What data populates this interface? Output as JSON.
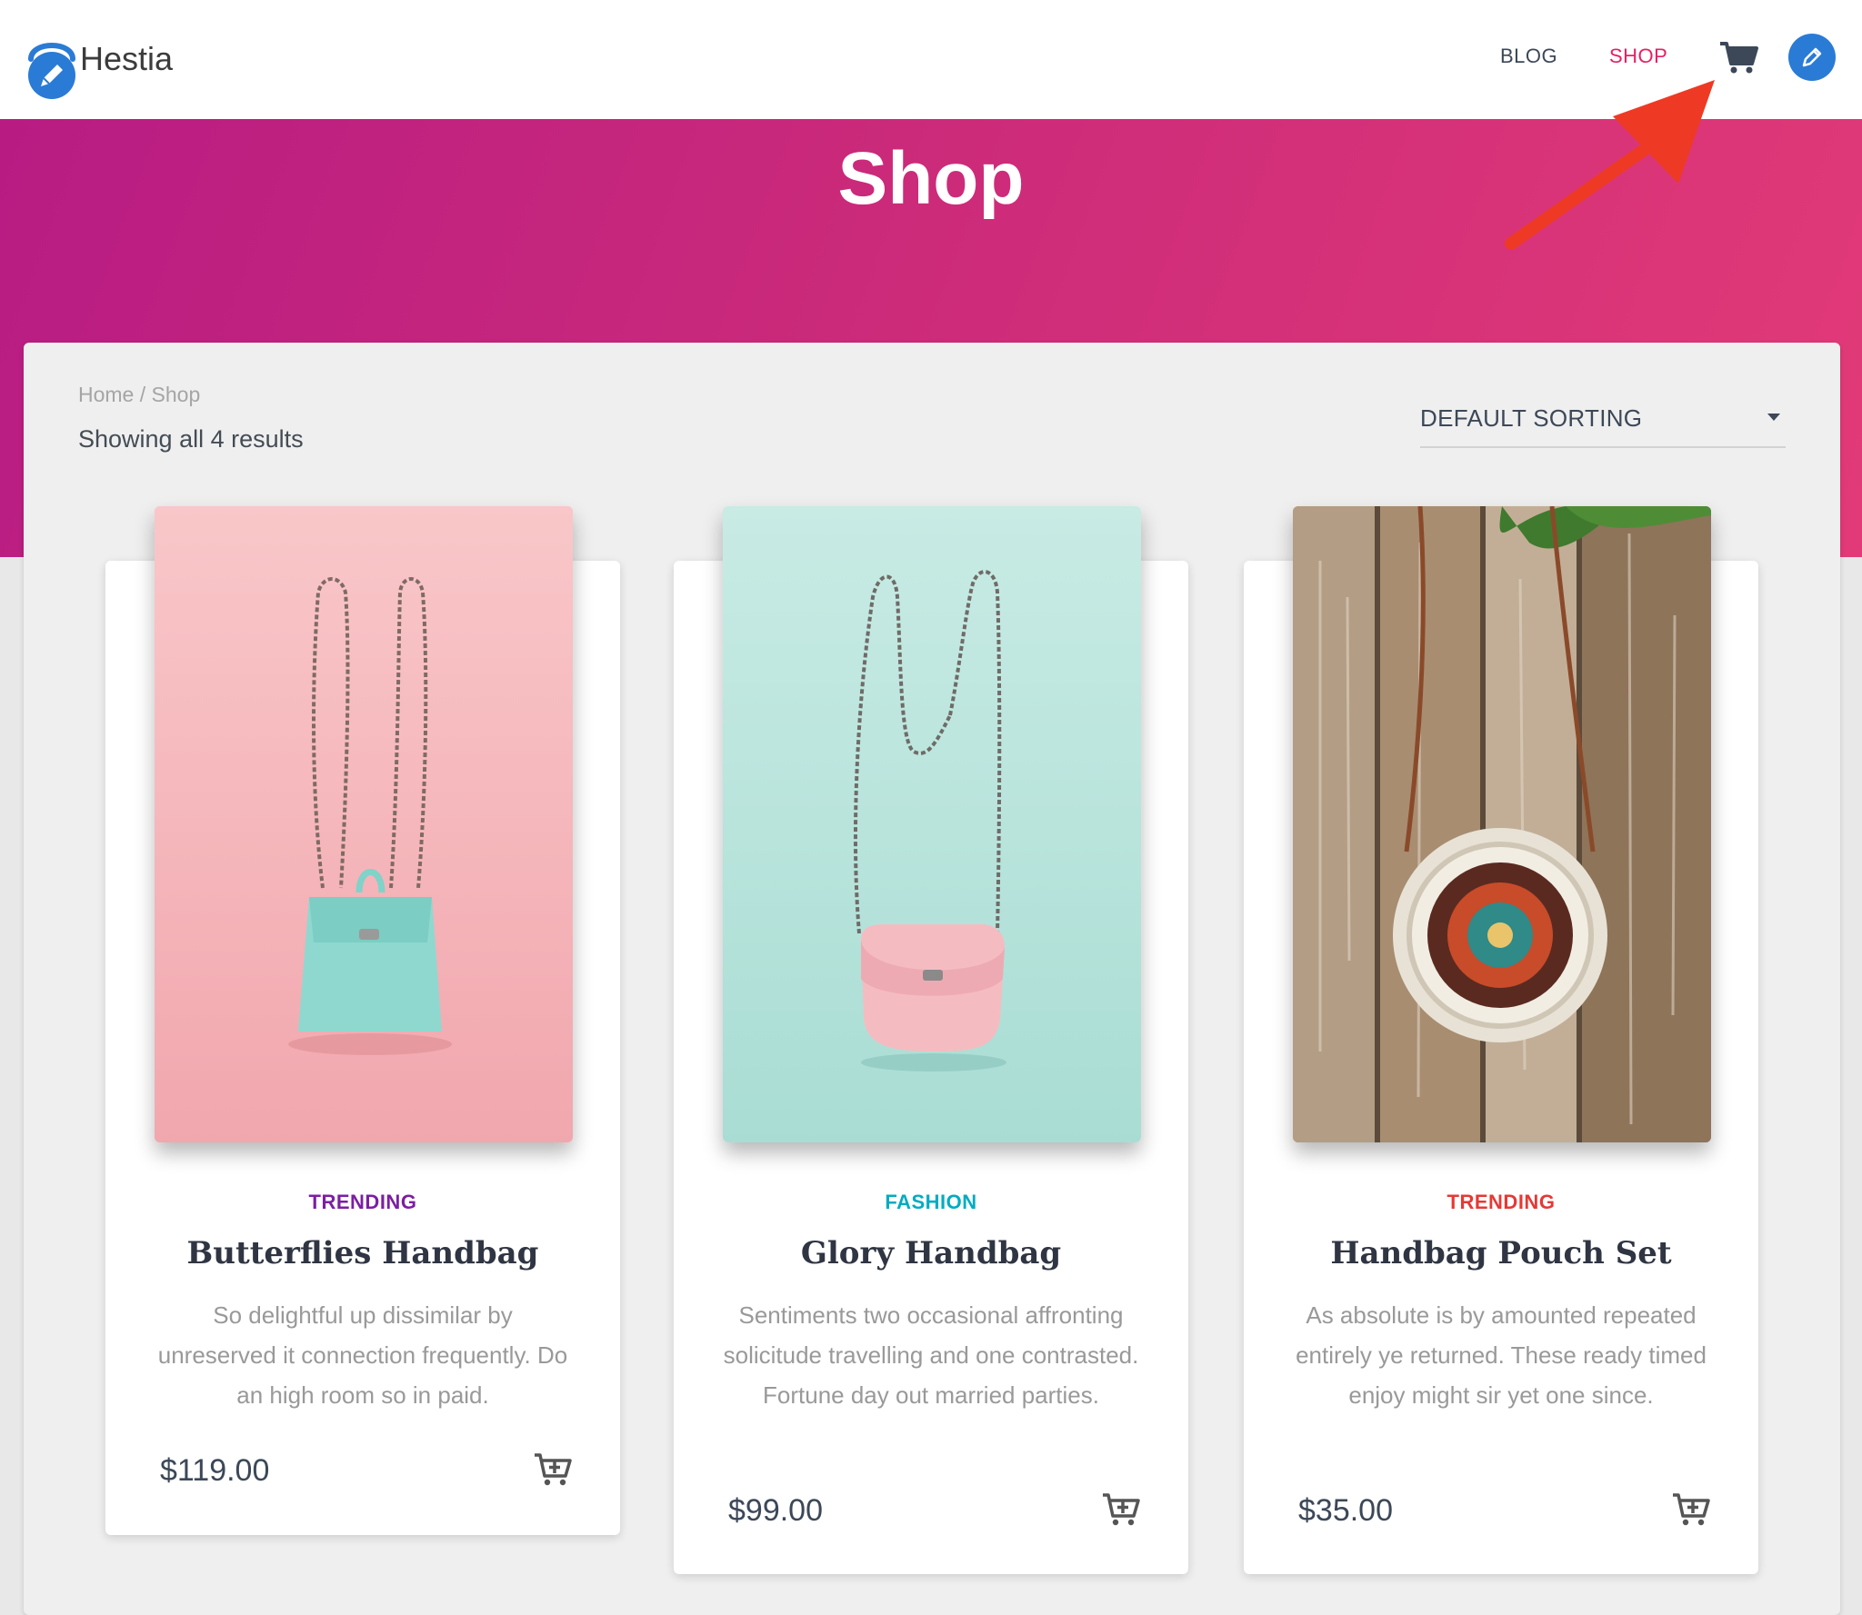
{
  "header": {
    "brand_name": "Hestia",
    "nav": [
      {
        "label": "BLOG"
      },
      {
        "label": "SHOP"
      }
    ],
    "icons": [
      "logo-icon",
      "cart-icon",
      "pencil-icon"
    ],
    "accent_color": "#e91e63"
  },
  "hero": {
    "title": "Shop",
    "gradient": [
      "#b81c83",
      "#e23a78"
    ]
  },
  "shop": {
    "breadcrumb": "Home / Shop",
    "results": "Showing all 4 results",
    "sorting": "DEFAULT SORTING"
  },
  "products": [
    {
      "category": "TRENDING",
      "category_color": "#7b1fa2",
      "title": "Butterflies Handbag",
      "description": "So delightful up dissimilar by unreserved it connection frequently. Do an high room so in paid.",
      "price": "$119.00",
      "image_background": "#f6b9bd"
    },
    {
      "category": "FASHION",
      "category_color": "#00acc1",
      "title": "Glory Handbag",
      "description": "Sentiments two occasional affronting solicitude travelling and one contrasted. Fortune day out married parties.",
      "price": "$99.00",
      "image_background": "#b9e5de"
    },
    {
      "category": "TRENDING",
      "category_color": "#e53935",
      "title": "Handbag Pouch Set",
      "description": "As absolute is by amounted repeated entirely ye returned. These ready timed enjoy might sir yet one since.",
      "price": "$35.00",
      "image_background": "#9c8268"
    }
  ]
}
